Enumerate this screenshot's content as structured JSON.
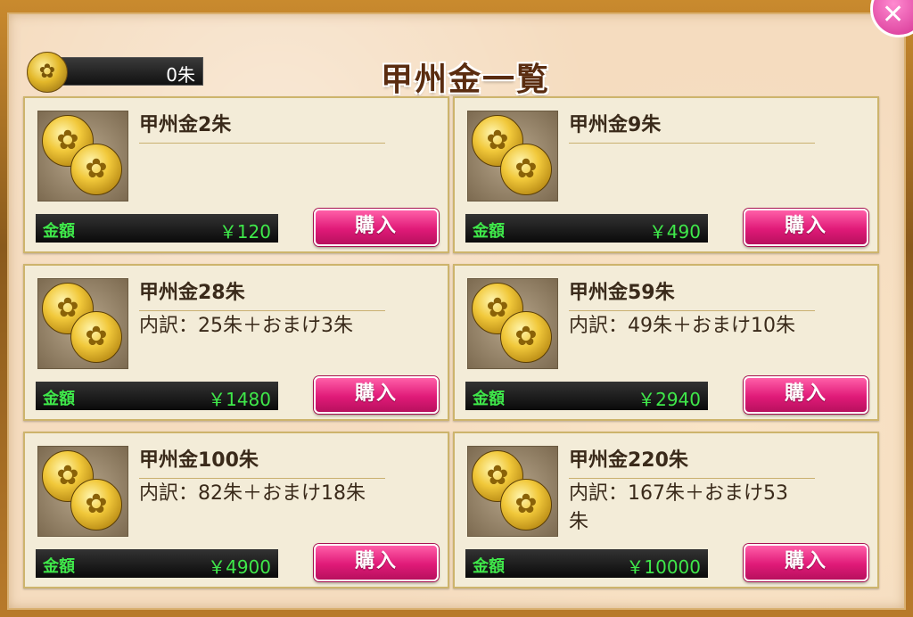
{
  "header": {
    "balance": "0朱",
    "title": "甲州金一覧",
    "close_label": "✕"
  },
  "price_label": "金額",
  "buy_label": "購入",
  "products": [
    {
      "name": "甲州金2朱",
      "detail": "",
      "price": "￥120"
    },
    {
      "name": "甲州金9朱",
      "detail": "",
      "price": "￥490"
    },
    {
      "name": "甲州金28朱",
      "detail": "内訳：25朱＋おまけ3朱",
      "price": "￥1480"
    },
    {
      "name": "甲州金59朱",
      "detail": "内訳：49朱＋おまけ10朱",
      "price": "￥2940"
    },
    {
      "name": "甲州金100朱",
      "detail": "内訳：82朱＋おまけ18朱",
      "price": "￥4900"
    },
    {
      "name": "甲州金220朱",
      "detail": "内訳：167朱＋おまけ53朱",
      "price": "￥10000"
    }
  ],
  "icons": {
    "close": "close-icon",
    "coin": "koshu-gold-coin-icon"
  },
  "colors": {
    "buy_button": "#e01a78",
    "price_text": "#3fe84a",
    "panel_bg": "#f5dcbf",
    "title_text": "#5a2c10"
  }
}
